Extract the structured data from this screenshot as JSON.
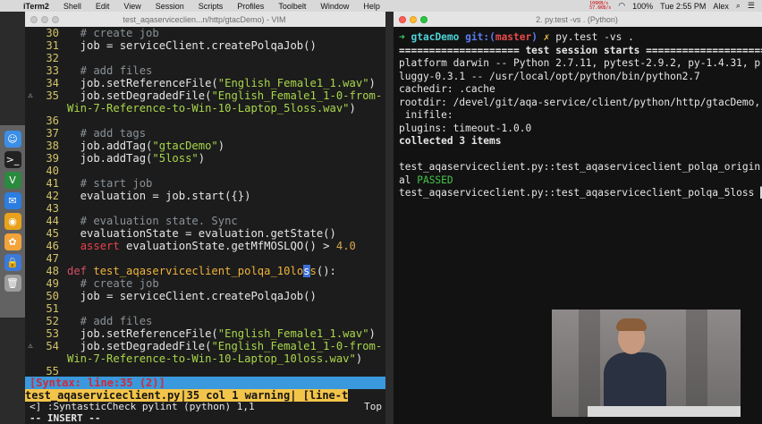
{
  "menubar": {
    "apple": "",
    "app": "iTerm2",
    "items": [
      "Shell",
      "Edit",
      "View",
      "Session",
      "Scripts",
      "Profiles",
      "Toolbelt",
      "Window",
      "Help"
    ],
    "net_up": "106KB/s",
    "net_down": "57.6KB/s",
    "battery": "100%",
    "time": "Tue 2:55 PM",
    "user": "Alex"
  },
  "vim": {
    "title": "test_aqaserviceclien...n/http/gtacDemo) - VIM",
    "lines": [
      {
        "n": "30",
        "sign": "",
        "segs": [
          {
            "t": "  # create job",
            "c": "cmt"
          }
        ]
      },
      {
        "n": "31",
        "sign": "",
        "segs": [
          {
            "t": "  job = serviceClient.createPolqaJob()",
            "c": ""
          }
        ]
      },
      {
        "n": "32",
        "sign": "",
        "segs": [
          {
            "t": "",
            "c": ""
          }
        ]
      },
      {
        "n": "33",
        "sign": "",
        "segs": [
          {
            "t": "  # add files",
            "c": "cmt"
          }
        ]
      },
      {
        "n": "34",
        "sign": "",
        "segs": [
          {
            "t": "  job.setReferenceFile(",
            "c": ""
          },
          {
            "t": "\"English_Female1_1.wav\"",
            "c": "str"
          },
          {
            "t": ")",
            "c": ""
          }
        ]
      },
      {
        "n": "35",
        "sign": "⚠",
        "segs": [
          {
            "t": "  job.setDegradedFile(",
            "c": ""
          },
          {
            "t": "\"English_Female1_1-0-from-",
            "c": "str"
          }
        ]
      },
      {
        "n": "",
        "sign": "",
        "segs": [
          {
            "t": "Win-7-Reference-to-Win-10-Laptop_5loss.wav\"",
            "c": "str"
          },
          {
            "t": ")",
            "c": ""
          }
        ]
      },
      {
        "n": "36",
        "sign": "",
        "segs": [
          {
            "t": "",
            "c": ""
          }
        ]
      },
      {
        "n": "37",
        "sign": "",
        "segs": [
          {
            "t": "  # add tags",
            "c": "cmt"
          }
        ]
      },
      {
        "n": "38",
        "sign": "",
        "segs": [
          {
            "t": "  job.addTag(",
            "c": ""
          },
          {
            "t": "\"gtacDemo\"",
            "c": "str"
          },
          {
            "t": ")",
            "c": ""
          }
        ]
      },
      {
        "n": "39",
        "sign": "",
        "segs": [
          {
            "t": "  job.addTag(",
            "c": ""
          },
          {
            "t": "\"5loss\"",
            "c": "str"
          },
          {
            "t": ")",
            "c": ""
          }
        ]
      },
      {
        "n": "40",
        "sign": "",
        "segs": [
          {
            "t": "",
            "c": ""
          }
        ]
      },
      {
        "n": "41",
        "sign": "",
        "segs": [
          {
            "t": "  # start job",
            "c": "cmt"
          }
        ]
      },
      {
        "n": "42",
        "sign": "",
        "segs": [
          {
            "t": "  evaluation = job.start({})",
            "c": ""
          }
        ]
      },
      {
        "n": "43",
        "sign": "",
        "segs": [
          {
            "t": "",
            "c": ""
          }
        ]
      },
      {
        "n": "44",
        "sign": "",
        "segs": [
          {
            "t": "  # evaluation state. Sync",
            "c": "cmt"
          }
        ]
      },
      {
        "n": "45",
        "sign": "",
        "segs": [
          {
            "t": "  evaluationState = evaluation.getState()",
            "c": ""
          }
        ]
      },
      {
        "n": "46",
        "sign": "",
        "segs": [
          {
            "t": "  ",
            "c": ""
          },
          {
            "t": "assert",
            "c": "kw"
          },
          {
            "t": " evaluationState.getMfMOSLQO() > ",
            "c": ""
          },
          {
            "t": "4.0",
            "c": "num"
          }
        ]
      },
      {
        "n": "47",
        "sign": "",
        "segs": [
          {
            "t": "",
            "c": ""
          }
        ]
      },
      {
        "n": "48",
        "sign": "",
        "segs": [
          {
            "t": "def",
            "c": "dl"
          },
          {
            "t": " ",
            "c": ""
          },
          {
            "t": "test_aqaserviceclient_polqa_10lo",
            "c": "fn"
          },
          {
            "t": "s",
            "c": "cur"
          },
          {
            "t": "s",
            "c": "fn"
          },
          {
            "t": "():",
            "c": ""
          }
        ]
      },
      {
        "n": "49",
        "sign": "",
        "segs": [
          {
            "t": "  # create job",
            "c": "cmt"
          }
        ]
      },
      {
        "n": "50",
        "sign": "",
        "segs": [
          {
            "t": "  job = serviceClient.createPolqaJob()",
            "c": ""
          }
        ]
      },
      {
        "n": "51",
        "sign": "",
        "segs": [
          {
            "t": "",
            "c": ""
          }
        ]
      },
      {
        "n": "52",
        "sign": "",
        "segs": [
          {
            "t": "  # add files",
            "c": "cmt"
          }
        ]
      },
      {
        "n": "53",
        "sign": "",
        "segs": [
          {
            "t": "  job.setReferenceFile(",
            "c": ""
          },
          {
            "t": "\"English_Female1_1.wav\"",
            "c": "str"
          },
          {
            "t": ")",
            "c": ""
          }
        ]
      },
      {
        "n": "54",
        "sign": "⚠",
        "segs": [
          {
            "t": "  job.setDegradedFile(",
            "c": ""
          },
          {
            "t": "\"English_Female1_1-0-from-",
            "c": "str"
          }
        ]
      },
      {
        "n": "",
        "sign": "",
        "segs": [
          {
            "t": "Win-7-Reference-to-Win-10-Laptop_10loss.wav\"",
            "c": "str"
          },
          {
            "t": ")",
            "c": ""
          }
        ]
      },
      {
        "n": "55",
        "sign": "",
        "segs": [
          {
            "t": "",
            "c": ""
          }
        ]
      }
    ],
    "syntax_bar": "[Syntax: line:35 (2)]",
    "status": "test_aqaserviceclient.py|35 col 1 warning| [line-t",
    "cmd": "<] :SyntasticCheck pylint (python) 1,1",
    "cmd_pos": "Top",
    "mode": "-- INSERT --"
  },
  "terminal": {
    "title": "2. py.test -vs . (Python)",
    "prompt": {
      "arrow": "➜",
      "dir": "gtacDemo",
      "git": "git:(",
      "branch": "master",
      "git_close": ")",
      "x": "✗",
      "cmd": "py.test -vs ."
    },
    "lines": [
      {
        "segs": [
          {
            "t": "==================== test session starts ====================",
            "c": "bold"
          }
        ]
      },
      {
        "segs": [
          {
            "t": "platform darwin -- Python 2.7.11, pytest-2.9.2, py-1.4.31, p",
            "c": ""
          }
        ]
      },
      {
        "segs": [
          {
            "t": "luggy-0.3.1 -- /usr/local/opt/python/bin/python2.7",
            "c": ""
          }
        ]
      },
      {
        "segs": [
          {
            "t": "cachedir: .cache",
            "c": ""
          }
        ]
      },
      {
        "segs": [
          {
            "t": "rootdir: /devel/git/aqa-service/client/python/http/gtacDemo,",
            "c": ""
          }
        ]
      },
      {
        "segs": [
          {
            "t": " inifile:",
            "c": ""
          }
        ]
      },
      {
        "segs": [
          {
            "t": "plugins: timeout-1.0.0",
            "c": ""
          }
        ]
      },
      {
        "segs": [
          {
            "t": "collected 3 items",
            "c": "bold"
          }
        ]
      },
      {
        "segs": [
          {
            "t": "",
            "c": ""
          }
        ]
      },
      {
        "segs": [
          {
            "t": "test_aqaserviceclient.py::test_aqaserviceclient_polqa_origin",
            "c": ""
          }
        ]
      },
      {
        "segs": [
          {
            "t": "al ",
            "c": ""
          },
          {
            "t": "PASSED",
            "c": "passed"
          }
        ]
      },
      {
        "segs": [
          {
            "t": "test_aqaserviceclient.py::test_aqaserviceclient_polqa_5loss ",
            "c": ""
          },
          {
            "t": "█",
            "c": "tcursor"
          }
        ]
      }
    ]
  },
  "dock": {
    "icons": [
      {
        "name": "finder-icon",
        "glyph": "☺",
        "color": "#3c8ee6"
      },
      {
        "name": "terminal-icon",
        "glyph": ">_",
        "color": "#222222"
      },
      {
        "name": "vim-icon",
        "glyph": "V",
        "color": "#2b8a3e"
      },
      {
        "name": "chat-icon",
        "glyph": "✉",
        "color": "#2c7de0"
      },
      {
        "name": "chrome-icon",
        "glyph": "◉",
        "color": "#e8a21c"
      },
      {
        "name": "photos-icon",
        "glyph": "✿",
        "color": "#f2a33a"
      },
      {
        "name": "lock-icon",
        "glyph": "🔒",
        "color": "#3c79d8"
      },
      {
        "name": "trash-icon",
        "glyph": "🗑",
        "color": "#9c9c9c"
      }
    ]
  }
}
